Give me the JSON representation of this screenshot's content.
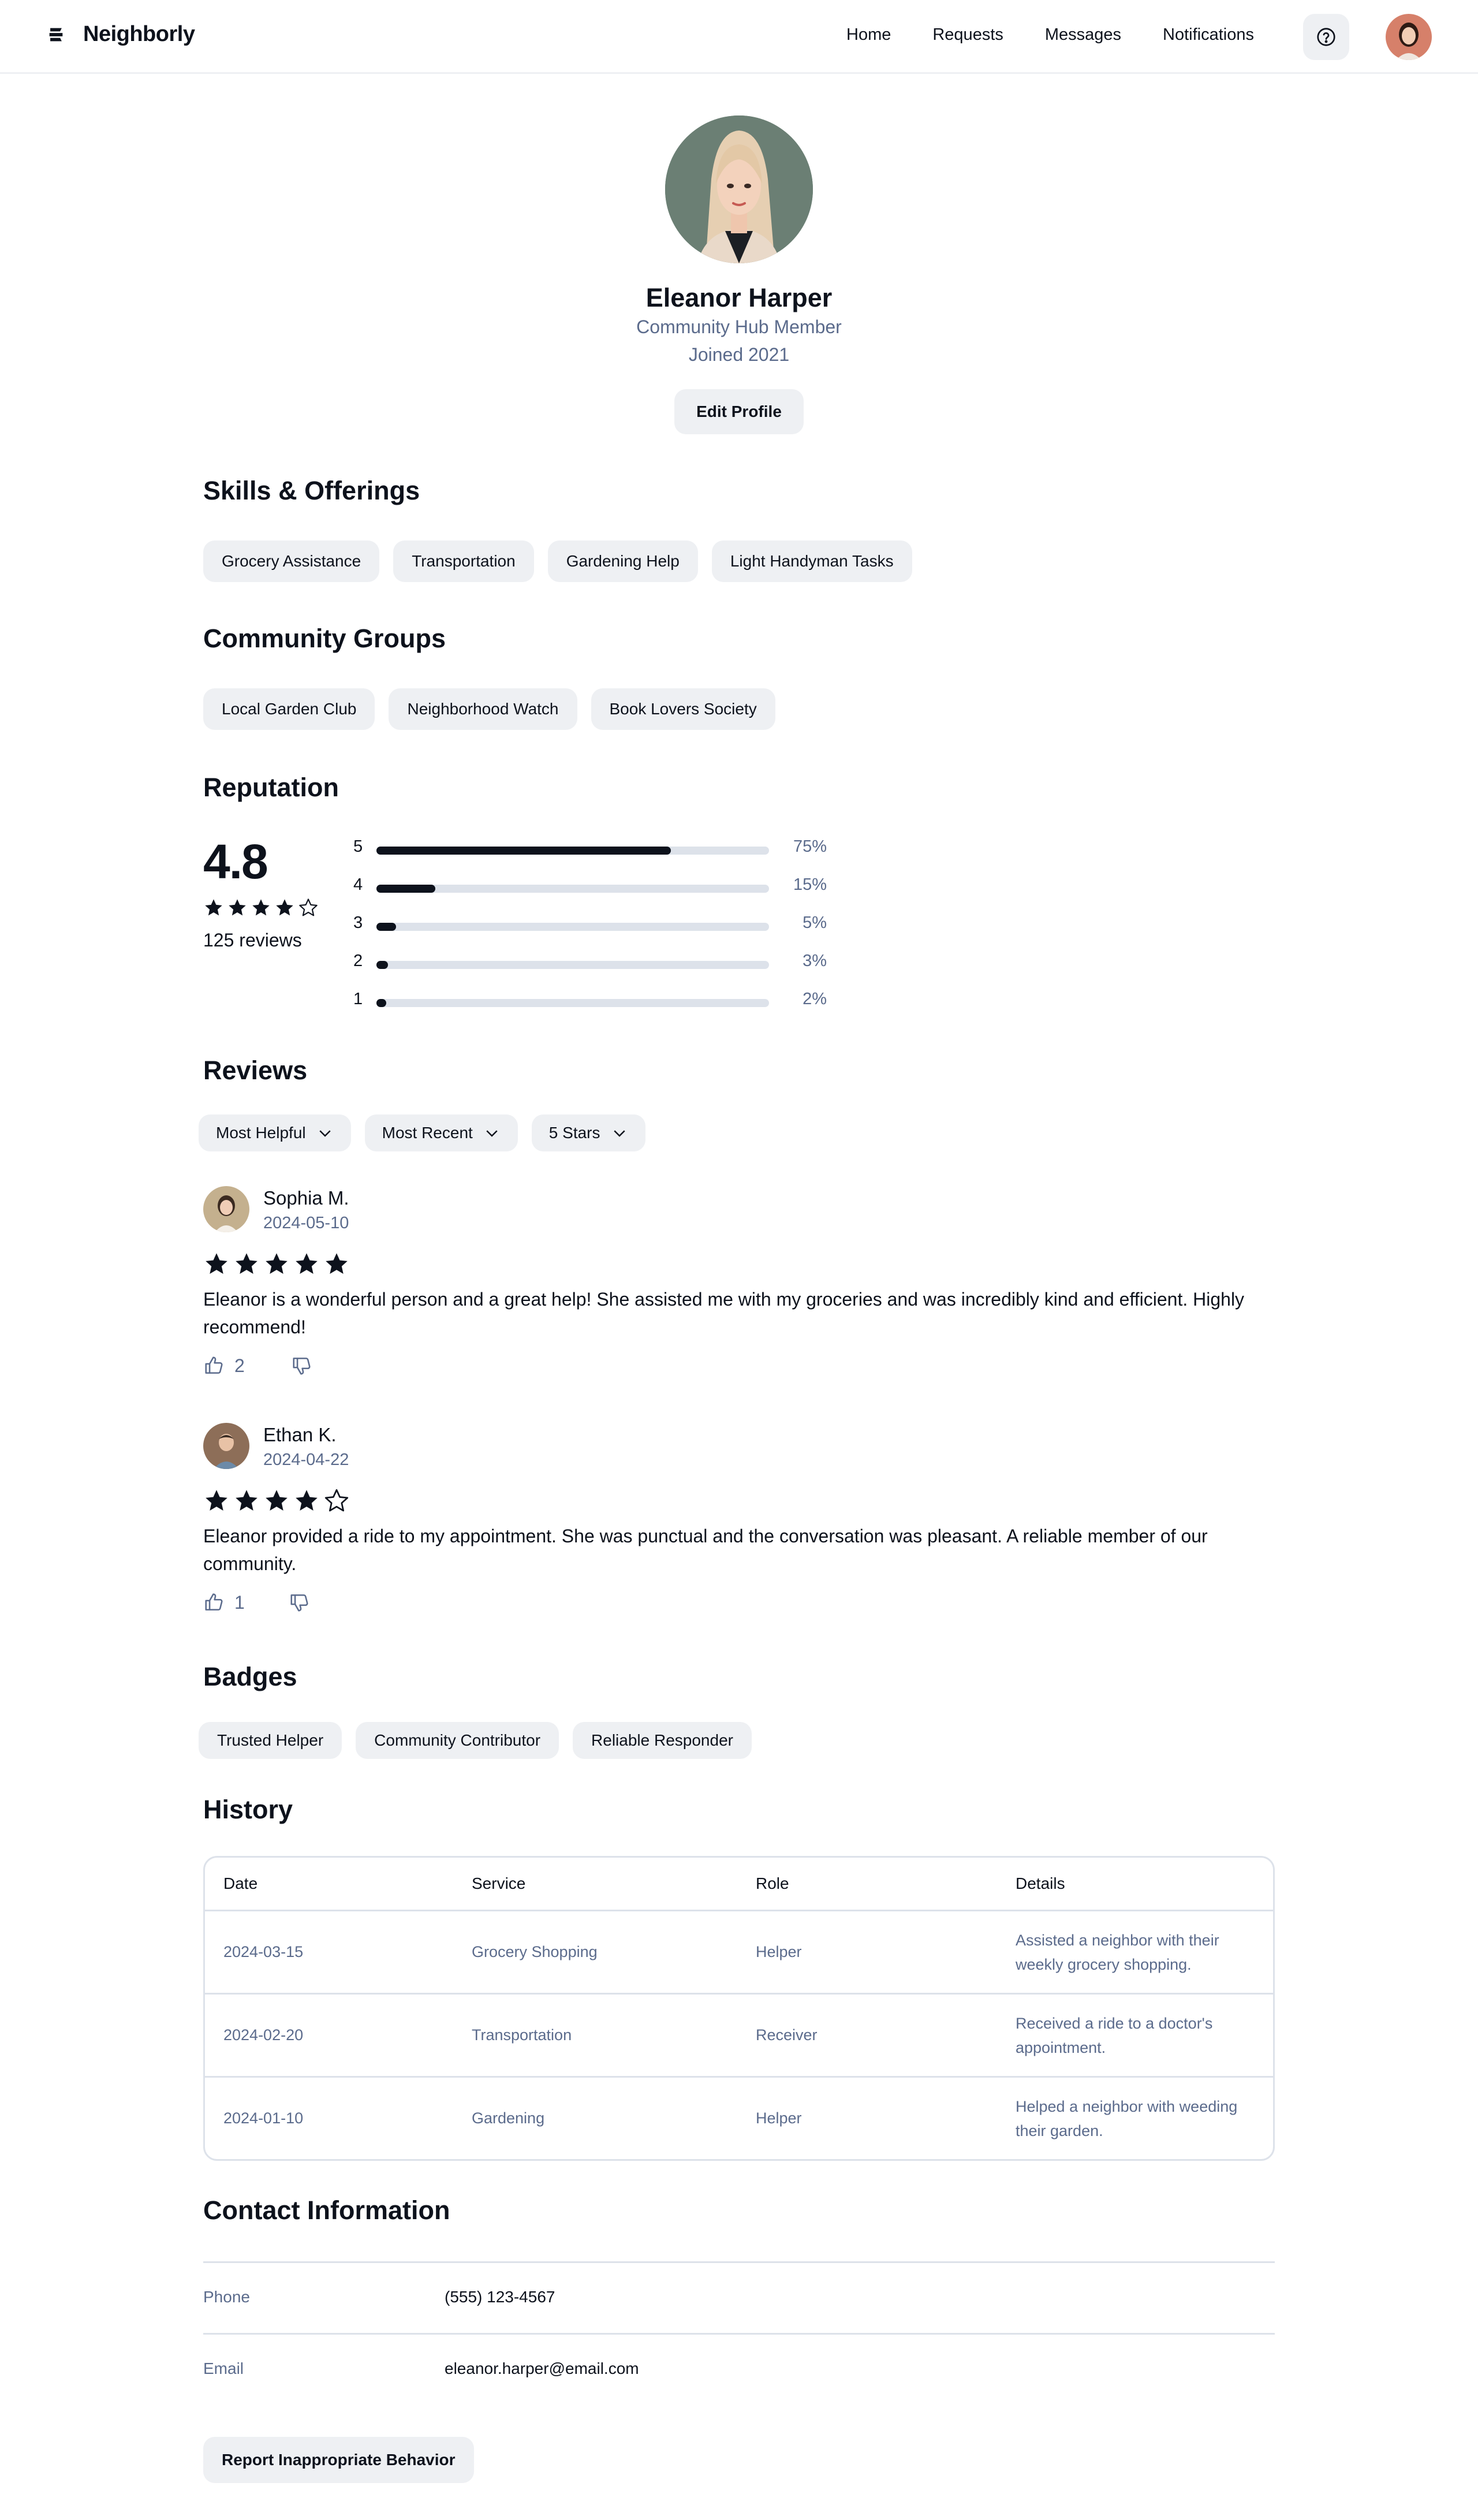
{
  "header": {
    "brand": "Neighborly",
    "nav": [
      "Home",
      "Requests",
      "Messages",
      "Notifications"
    ]
  },
  "profile": {
    "name": "Eleanor Harper",
    "role": "Community Hub Member",
    "joined": "Joined 2021",
    "edit_label": "Edit Profile"
  },
  "skills": {
    "title": "Skills & Offerings",
    "items": [
      "Grocery Assistance",
      "Transportation",
      "Gardening Help",
      "Light Handyman Tasks"
    ]
  },
  "groups": {
    "title": "Community Groups",
    "items": [
      "Local Garden Club",
      "Neighborhood Watch",
      "Book Lovers Society"
    ]
  },
  "reputation": {
    "title": "Reputation",
    "average": "4.8",
    "stars_filled": 4,
    "review_count": "125 reviews",
    "distribution": [
      {
        "star": "5",
        "percent": 75,
        "label": "75%"
      },
      {
        "star": "4",
        "percent": 15,
        "label": "15%"
      },
      {
        "star": "3",
        "percent": 5,
        "label": "5%"
      },
      {
        "star": "2",
        "percent": 3,
        "label": "3%"
      },
      {
        "star": "1",
        "percent": 2,
        "label": "2%"
      }
    ]
  },
  "reviews": {
    "title": "Reviews",
    "filters": [
      "Most Helpful",
      "Most Recent",
      "5 Stars"
    ],
    "items": [
      {
        "name": "Sophia M.",
        "date": "2024-05-10",
        "stars": 5,
        "text": "Eleanor is a wonderful person and a great help! She assisted me with my groceries and was incredibly kind and efficient. Highly recommend!",
        "likes": "2"
      },
      {
        "name": "Ethan K.",
        "date": "2024-04-22",
        "stars": 4,
        "text": "Eleanor provided a ride to my appointment. She was punctual and the conversation was pleasant. A reliable member of our community.",
        "likes": "1"
      }
    ]
  },
  "badges": {
    "title": "Badges",
    "items": [
      "Trusted Helper",
      "Community Contributor",
      "Reliable Responder"
    ]
  },
  "history": {
    "title": "History",
    "columns": [
      "Date",
      "Service",
      "Role",
      "Details"
    ],
    "rows": [
      [
        "2024-03-15",
        "Grocery Shopping",
        "Helper",
        "Assisted a neighbor with their weekly grocery shopping."
      ],
      [
        "2024-02-20",
        "Transportation",
        "Receiver",
        "Received a ride to a doctor's appointment."
      ],
      [
        "2024-01-10",
        "Gardening",
        "Helper",
        "Helped a neighbor with weeding their garden."
      ]
    ]
  },
  "contact": {
    "title": "Contact Information",
    "phone_label": "Phone",
    "phone": "(555) 123-4567",
    "email_label": "Email",
    "email": "eleanor.harper@email.com"
  },
  "report_label": "Report Inappropriate Behavior",
  "colors": {
    "text": "#0d121c",
    "muted": "#5b6b8c",
    "chip_bg": "#eef0f3",
    "border": "#dde2ea"
  }
}
